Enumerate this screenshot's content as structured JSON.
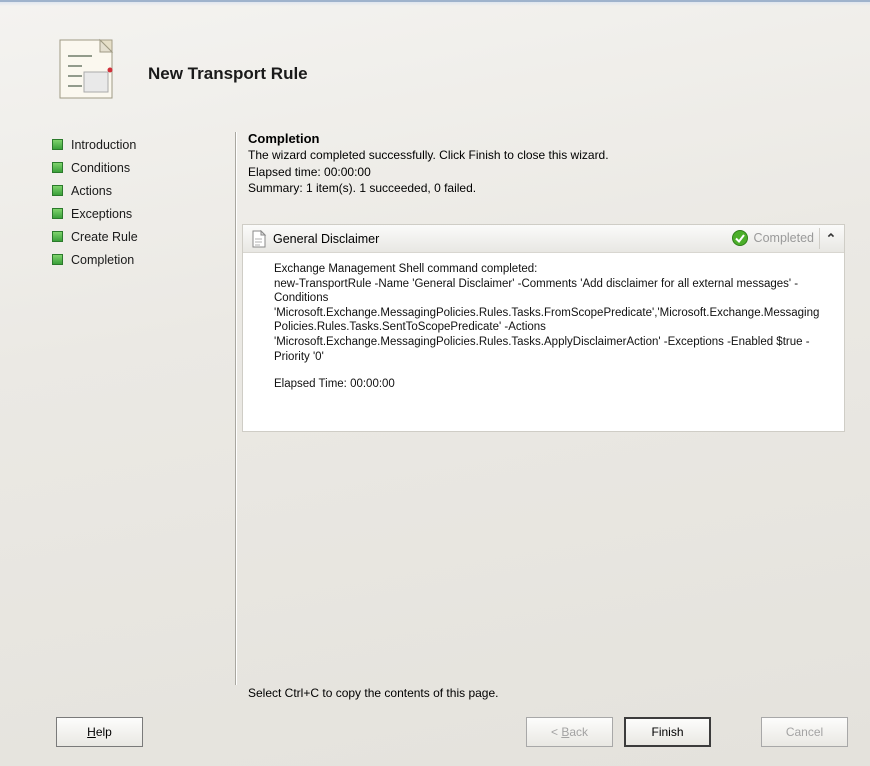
{
  "wizard": {
    "title": "New Transport Rule"
  },
  "steps": [
    {
      "label": "Introduction"
    },
    {
      "label": "Conditions"
    },
    {
      "label": "Actions"
    },
    {
      "label": "Exceptions"
    },
    {
      "label": "Create Rule"
    },
    {
      "label": "Completion"
    }
  ],
  "content": {
    "heading": "Completion",
    "message": "The wizard completed successfully. Click Finish to close this wizard.",
    "elapsed": "Elapsed time: 00:00:00",
    "summary": "Summary: 1 item(s). 1 succeeded, 0 failed."
  },
  "result": {
    "title": "General Disclaimer",
    "status": "Completed",
    "status_color": "#4caf2a",
    "command_intro": "Exchange Management Shell command completed:",
    "command": "new-TransportRule -Name 'General Disclaimer' -Comments 'Add disclaimer for all external messages' -Conditions 'Microsoft.Exchange.MessagingPolicies.Rules.Tasks.FromScopePredicate','Microsoft.Exchange.MessagingPolicies.Rules.Tasks.SentToScopePredicate' -Actions 'Microsoft.Exchange.MessagingPolicies.Rules.Tasks.ApplyDisclaimerAction' -Exceptions -Enabled $true -Priority '0'",
    "elapsed": "Elapsed Time: 00:00:00"
  },
  "hint": "Select Ctrl+C to copy the contents of this page.",
  "buttons": {
    "help_prefix": "",
    "help_key": "H",
    "help_rest": "elp",
    "back_prefix": "< ",
    "back_key": "B",
    "back_rest": "ack",
    "finish": "Finish",
    "cancel": "Cancel"
  },
  "icons": {
    "header": "transport-rule-wizard-icon",
    "step_marker": "green-square-icon",
    "result": "document-icon",
    "status": "green-check-icon",
    "collapse": "double-chevron-up-icon"
  }
}
